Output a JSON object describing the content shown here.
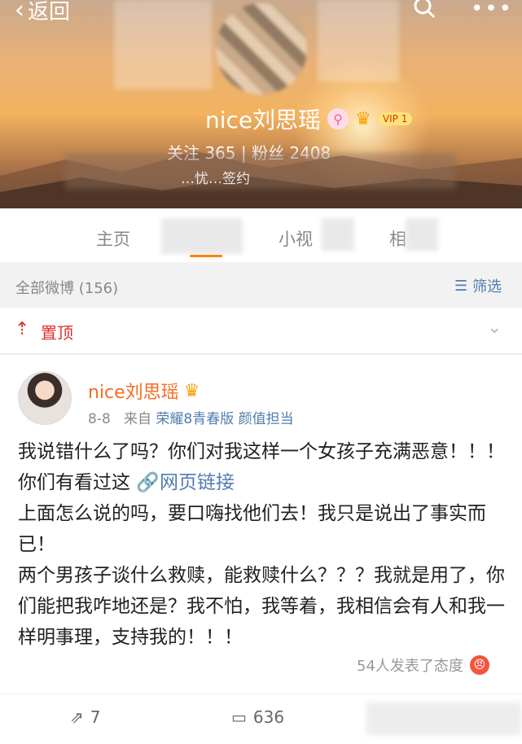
{
  "nav": {
    "back_label": "返回",
    "search_icon": "search-icon",
    "more_icon": "more-icon"
  },
  "profile": {
    "name": "nice刘思瑶",
    "vip_label": "VIP 1",
    "stats": "关注 365 | 粉丝 2408",
    "bio": "…忧…签约"
  },
  "tabs": [
    "主页",
    "小视",
    "相"
  ],
  "filterbar": {
    "count_label": "全部微博 (156)",
    "filter_label": "筛选"
  },
  "pinned": {
    "label": "置顶"
  },
  "post": {
    "author": "nice刘思瑶",
    "date": "8-8",
    "source_prefix": "来自",
    "source": "荣耀8青春版 颜值担当",
    "body_part1": "我说错什么了吗？你们对我这样一个女孩子充满恶意！！！你们有看过这",
    "link_text": "网页链接",
    "body_part2": "上面怎么说的吗，要口嗨找他们去！我只是说出了事实而已！",
    "body_part3": "两个男孩子谈什么救赎，能救赎什么？？？我就是用了，你们能把我咋地还是？我不怕，我等着，我相信会有人和我一样明事理，支持我的！！！",
    "attitude": "54人发表了态度"
  },
  "actions": {
    "repost_count": "7",
    "comment_count": "636"
  },
  "colors": {
    "accent": "#ff8200",
    "link": "#507daf",
    "pin": "#e0302d",
    "author": "#f86b1e"
  }
}
